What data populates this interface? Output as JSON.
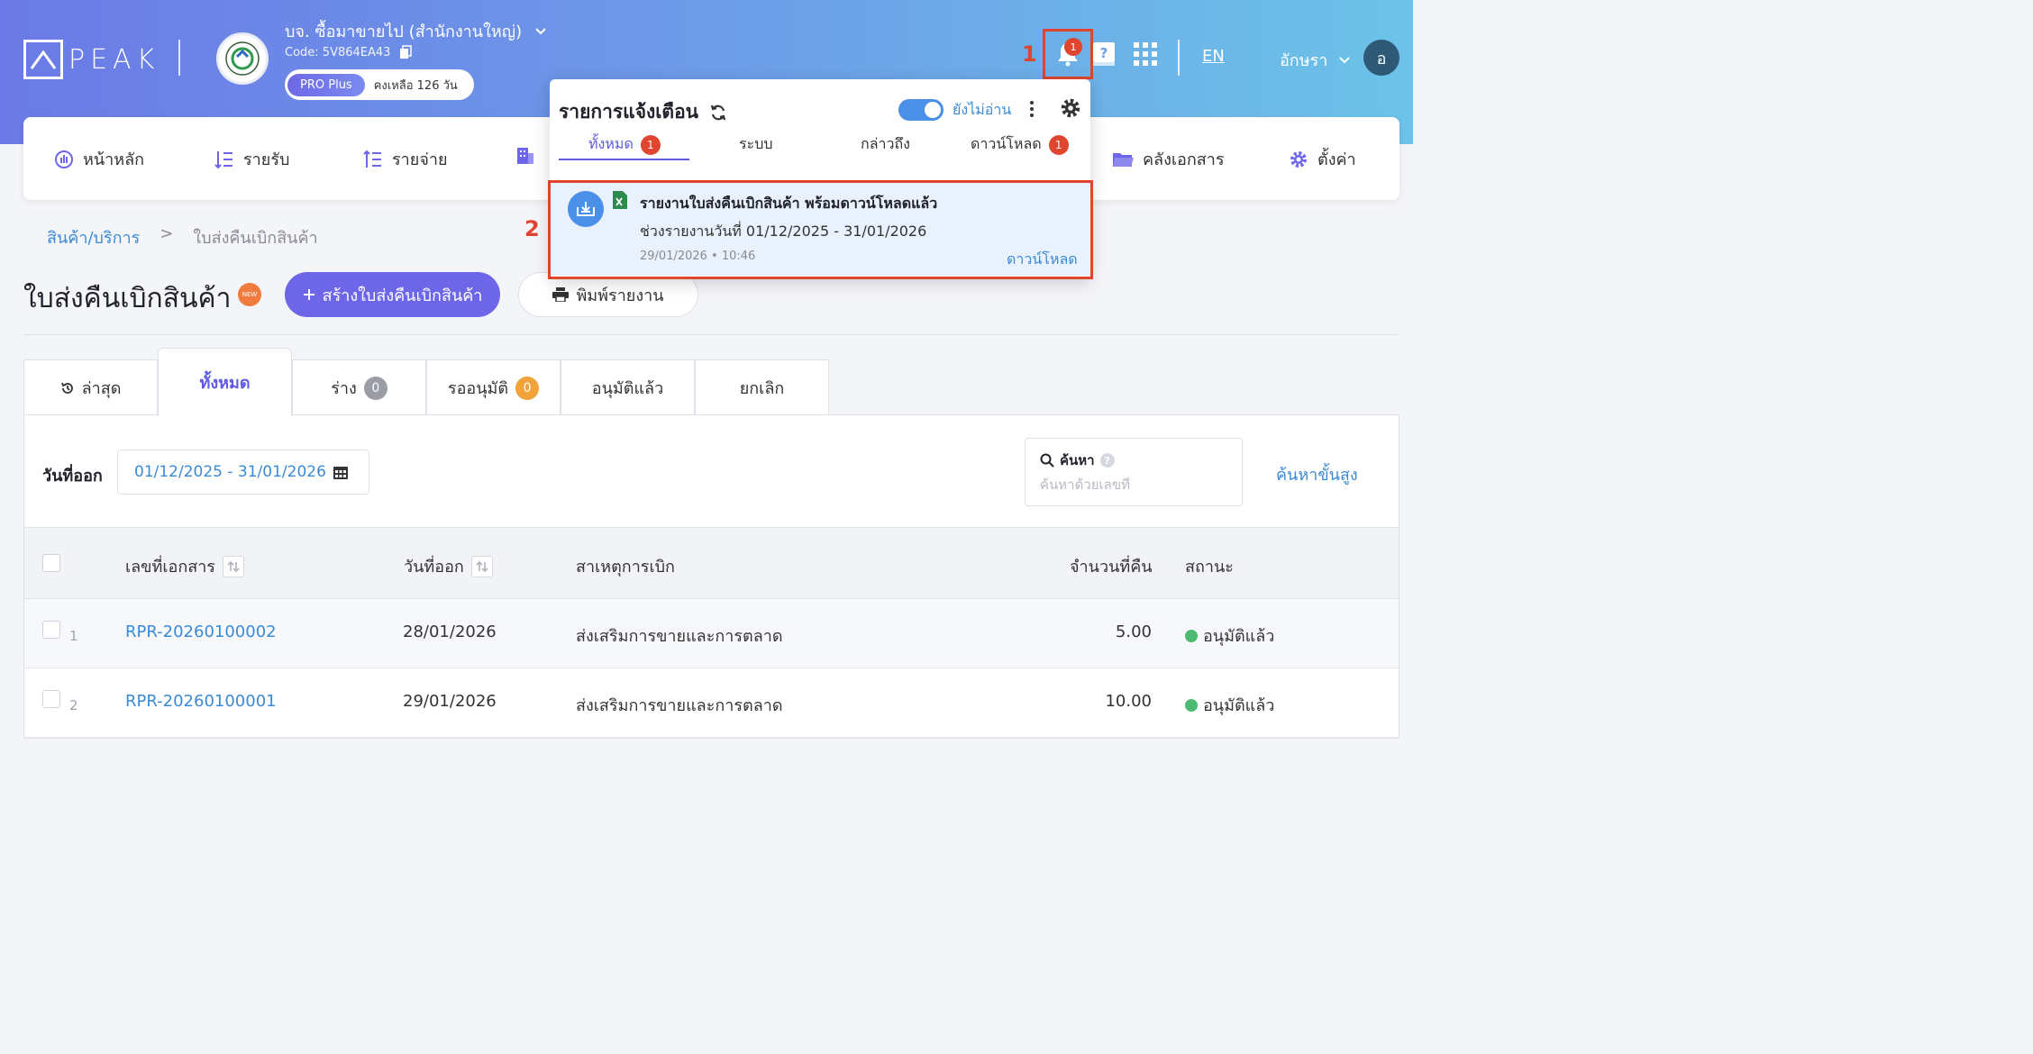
{
  "header": {
    "logo_text": "PEAK",
    "company_name": "บจ. ซื้อมาขายไป (สำนักงานใหญ่)",
    "company_code": "Code: 5V864EA43",
    "plan_badge": "PRO Plus",
    "plan_remaining": "คงเหลือ 126 วัน",
    "notification_count": "1",
    "language": "EN",
    "user_name": "อักษรา",
    "user_initial": "อ"
  },
  "annotations": {
    "marker_1": "1",
    "marker_2": "2"
  },
  "nav": {
    "items": [
      {
        "label": "หน้าหลัก",
        "icon": "dashboard-icon"
      },
      {
        "label": "รายรับ",
        "icon": "income-icon"
      },
      {
        "label": "รายจ่าย",
        "icon": "expense-icon"
      },
      {
        "label": "",
        "icon": "building-icon"
      },
      {
        "label": "คลังเอกสาร",
        "icon": "folder-icon"
      },
      {
        "label": "ตั้งค่า",
        "icon": "gear-icon"
      }
    ]
  },
  "breadcrumb": {
    "parent": "สินค้า/บริการ",
    "separator": ">",
    "current": "ใบส่งคืนเบิกสินค้า"
  },
  "page": {
    "title": "ใบส่งคืนเบิกสินค้า",
    "new_badge": "NEW",
    "create_button": "สร้างใบส่งคืนเบิกสินค้า",
    "print_button": "พิมพ์รายงาน"
  },
  "tabs": [
    {
      "label": "ล่าสุด",
      "count": null
    },
    {
      "label": "ทั้งหมด",
      "count": null,
      "active": true
    },
    {
      "label": "ร่าง",
      "count": "0"
    },
    {
      "label": "รออนุมัติ",
      "count": "0"
    },
    {
      "label": "อนุมัติแล้ว",
      "count": null
    },
    {
      "label": "ยกเลิก",
      "count": null
    }
  ],
  "filters": {
    "date_label": "วันที่ออก",
    "date_range": "01/12/2025 - 31/01/2026",
    "search_label": "ค้นหา",
    "search_placeholder": "ค้นหาด้วยเลขที่",
    "advanced_search": "ค้นหาขั้นสูง"
  },
  "table": {
    "columns": [
      "เลขที่เอกสาร",
      "วันที่ออก",
      "สาเหตุการเบิก",
      "จำนวนที่คืน",
      "สถานะ"
    ],
    "rows": [
      {
        "num": "1",
        "doc_no": "RPR-20260100002",
        "date": "28/01/2026",
        "reason": "ส่งเสริมการขายและการตลาด",
        "qty": "5.00",
        "status": "อนุมัติแล้ว"
      },
      {
        "num": "2",
        "doc_no": "RPR-20260100001",
        "date": "29/01/2026",
        "reason": "ส่งเสริมการขายและการตลาด",
        "qty": "10.00",
        "status": "อนุมัติแล้ว"
      }
    ]
  },
  "notifications": {
    "title": "รายการแจ้งเตือน",
    "unread_toggle_label": "ยังไม่อ่าน",
    "tabs": [
      {
        "label": "ทั้งหมด",
        "count": "1",
        "active": true
      },
      {
        "label": "ระบบ",
        "count": null
      },
      {
        "label": "กล่าวถึง",
        "count": null
      },
      {
        "label": "ดาวน์โหลด",
        "count": "1"
      }
    ],
    "item": {
      "title": "รายงานใบส่งคืนเบิกสินค้า พร้อมดาวน์โหลดแล้ว",
      "body": "ช่วงรายงานวันที่ 01/12/2025 - 31/01/2026",
      "time": "29/01/2026 • 10:46",
      "action": "ดาวน์โหลด"
    }
  },
  "colors": {
    "accent": "#6e66e8",
    "link": "#3a8ad6",
    "alert": "#e0452f",
    "success": "#4cbb71"
  }
}
